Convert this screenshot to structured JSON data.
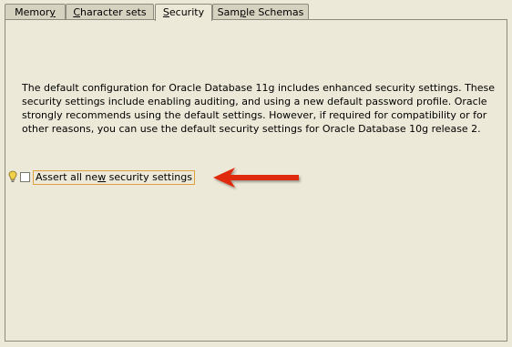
{
  "tabs": [
    {
      "pre": "Memor",
      "u": "y",
      "post": "",
      "active": false
    },
    {
      "pre": "",
      "u": "C",
      "post": "haracter sets",
      "active": false
    },
    {
      "pre": "",
      "u": "S",
      "post": "ecurity",
      "active": true
    },
    {
      "pre": "Sam",
      "u": "p",
      "post": "le Schemas",
      "active": false
    }
  ],
  "security": {
    "description_lines": [
      "The default configuration for Oracle Database 11g includes enhanced security settings. These",
      "security settings include enabling auditing, and using a new default password profile. Oracle",
      "strongly recommends using the default settings. However, if required for compatibility or for",
      "other reasons, you can use the default security settings for Oracle Database 10g release 2."
    ],
    "assert_checkbox": {
      "label_pre": "Assert all ne",
      "label_u": "w",
      "label_post": " security settings",
      "checked": false
    },
    "hint_icon": "lightbulb-icon"
  },
  "annotation": {
    "arrow_color": "#e02a10",
    "arrow_icon": "left-arrow-icon"
  }
}
